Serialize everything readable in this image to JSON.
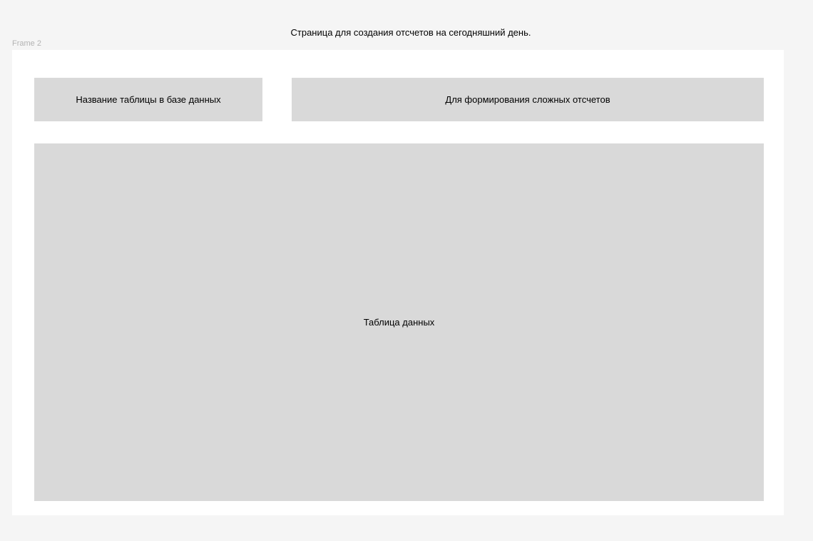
{
  "page": {
    "caption": "Страница для создания отсчетов на сегодняшний день."
  },
  "frame": {
    "label": "Frame 2",
    "table_name_block": "Название таблицы в базе данных",
    "complex_reports_block": "Для формирования сложных отсчетов",
    "data_table_block": "Таблица данных"
  },
  "colors": {
    "canvas": "#f5f5f5",
    "frame": "#ffffff",
    "block": "#d9d9d9",
    "frame_label": "#b3b3b3"
  }
}
